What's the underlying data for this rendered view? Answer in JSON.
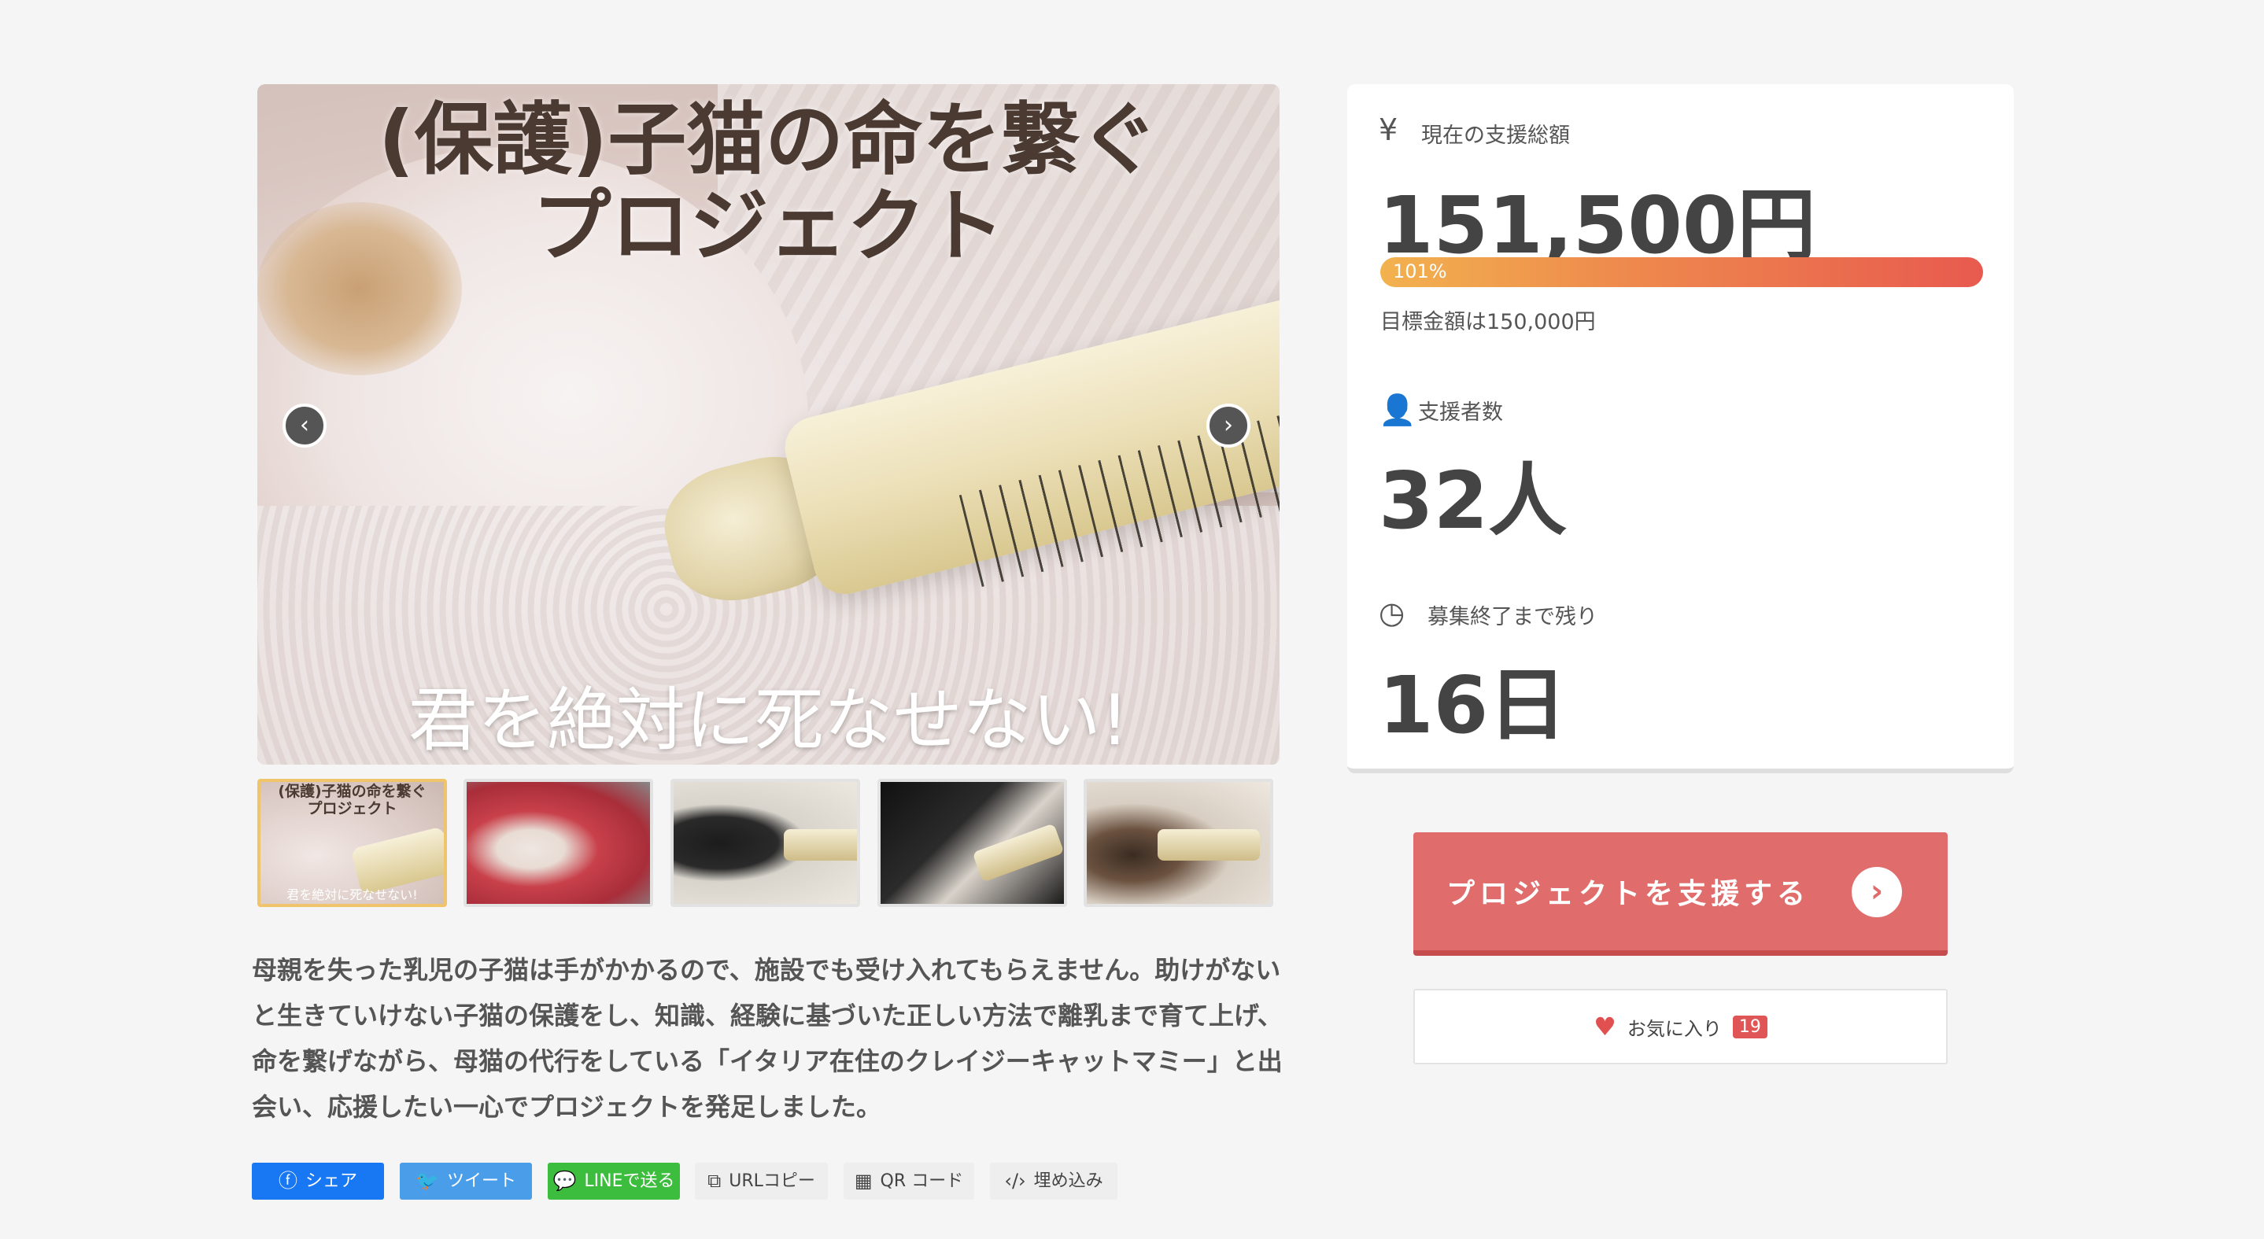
{
  "hero": {
    "title_line1": "(保護)子猫の命を繋ぐ",
    "title_line2": "プロジェクト",
    "subtitle": "君を絶対に死なせない!",
    "prev_icon": "chevron-left-icon",
    "next_icon": "chevron-right-icon"
  },
  "thumbnails": [
    {
      "caption_top": "(保護)子猫の命を繋ぐ\nプロジェクト",
      "caption_bottom": "君を絶対に死なせない!",
      "active": true
    },
    {
      "active": false
    },
    {
      "active": false
    },
    {
      "active": false
    },
    {
      "active": false
    }
  ],
  "description": "母親を失った乳児の子猫は手がかかるので、施設でも受け入れてもらえません。助けがないと生きていけない子猫の保護をし、知識、経験に基づいた正しい方法で離乳まで育て上げ、命を繋げながら、母猫の代行をしている「イタリア在住のクレイジーキャットマミー」と出会い、応援したい一心でプロジェクトを発足しました。",
  "share": {
    "facebook": "シェア",
    "twitter": "ツイート",
    "line": "LINEで送る",
    "url_copy": "URLコピー",
    "qr": "QR コード",
    "embed": "埋め込み"
  },
  "stats": {
    "total_label": "現在の支援総額",
    "total_value": "151,500円",
    "progress_percent": 101,
    "progress_label": "101%",
    "goal_text": "目標金額は150,000円",
    "supporters_label": "支援者数",
    "supporters_value": "32人",
    "remaining_label": "募集終了まで残り",
    "remaining_value": "16日"
  },
  "support_button": "プロジェクトを支援する",
  "favorite": {
    "label": "お気に入り",
    "count": "19"
  },
  "colors": {
    "accent": "#e06c6c",
    "facebook": "#1877f2",
    "twitter": "#4a9de8",
    "line": "#3dbd3d",
    "grey_button": "#eeeeee"
  }
}
